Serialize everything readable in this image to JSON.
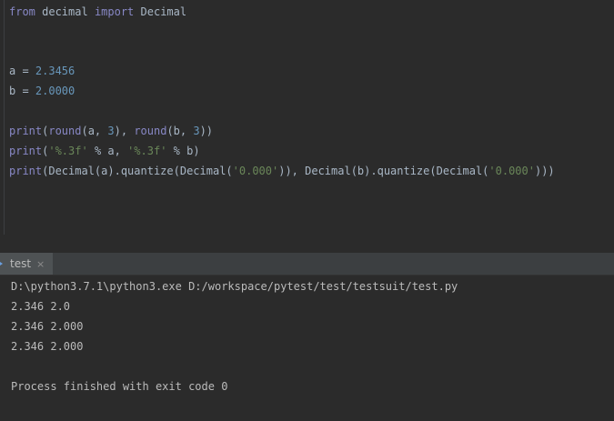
{
  "editor": {
    "lines": [
      {
        "parts": [
          {
            "t": "from",
            "c": "kw2"
          },
          {
            "t": " decimal ",
            "c": ""
          },
          {
            "t": "import",
            "c": "kw2"
          },
          {
            "t": " Decimal",
            "c": ""
          }
        ]
      },
      {
        "parts": [
          {
            "t": "a = ",
            "c": ""
          },
          {
            "t": "2.3456",
            "c": "num"
          }
        ]
      },
      {
        "parts": [
          {
            "t": "b = ",
            "c": ""
          },
          {
            "t": "2.0000",
            "c": "num"
          }
        ]
      },
      {
        "parts": [
          {
            "t": "print",
            "c": "fn"
          },
          {
            "t": "(",
            "c": ""
          },
          {
            "t": "round",
            "c": "fn"
          },
          {
            "t": "(a, ",
            "c": ""
          },
          {
            "t": "3",
            "c": "num"
          },
          {
            "t": "), ",
            "c": ""
          },
          {
            "t": "round",
            "c": "fn"
          },
          {
            "t": "(b, ",
            "c": ""
          },
          {
            "t": "3",
            "c": "num"
          },
          {
            "t": "))",
            "c": ""
          }
        ]
      },
      {
        "parts": [
          {
            "t": "print",
            "c": "fn"
          },
          {
            "t": "(",
            "c": ""
          },
          {
            "t": "'%.3f'",
            "c": "str"
          },
          {
            "t": " % a, ",
            "c": ""
          },
          {
            "t": "'%.3f'",
            "c": "str"
          },
          {
            "t": " % b)",
            "c": ""
          }
        ]
      },
      {
        "parts": [
          {
            "t": "print",
            "c": "fn"
          },
          {
            "t": "(Decimal(a).quantize(Decimal(",
            "c": ""
          },
          {
            "t": "'0.000'",
            "c": "str"
          },
          {
            "t": ")), Decimal(b).quantize(Decimal(",
            "c": ""
          },
          {
            "t": "'0.000'",
            "c": "str"
          },
          {
            "t": ")))",
            "c": ""
          }
        ]
      }
    ]
  },
  "run_panel": {
    "tab_label": "test",
    "close_glyph": "×"
  },
  "console": {
    "lines": [
      "D:\\python3.7.1\\python3.exe D:/workspace/pytest/test/testsuit/test.py",
      "2.346 2.0",
      "2.346 2.000",
      "2.346 2.000",
      "Process finished with exit code 0"
    ]
  }
}
